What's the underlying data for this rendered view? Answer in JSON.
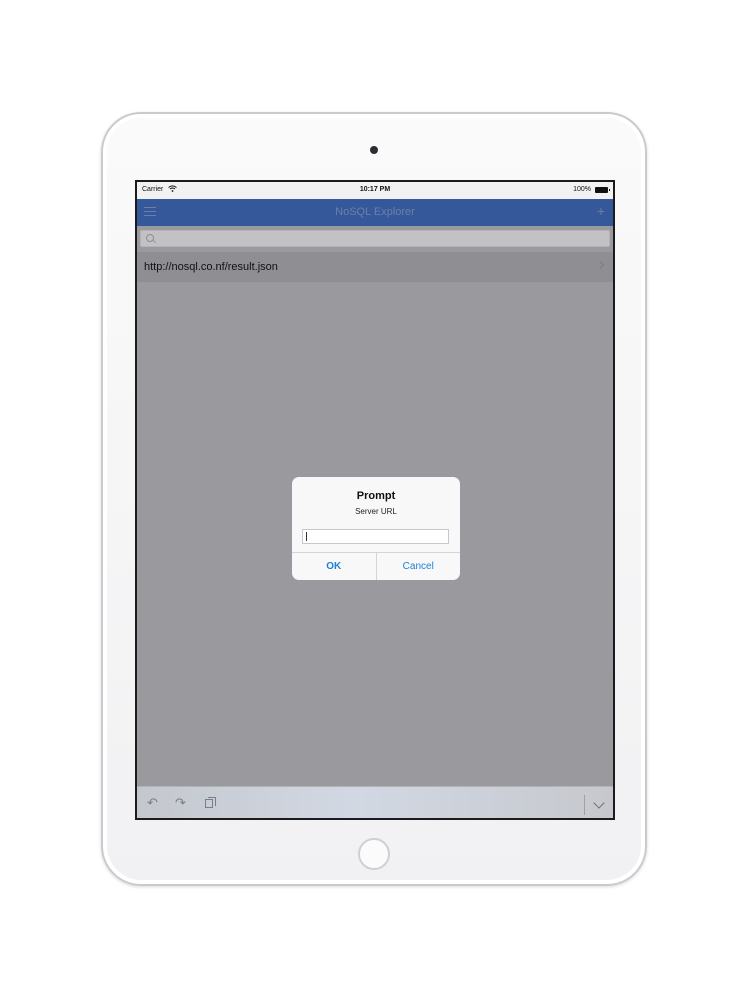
{
  "status_bar": {
    "carrier": "Carrier",
    "time": "10:17 PM",
    "battery": "100%"
  },
  "navbar": {
    "title": "NoSQL Explorer",
    "menu_icon": "hamburger-icon",
    "add_icon": "plus-icon"
  },
  "list": {
    "items": [
      {
        "label": "http://nosql.co.nf/result.json"
      }
    ]
  },
  "alert": {
    "title": "Prompt",
    "message": "Server URL",
    "input_value": "",
    "ok_label": "OK",
    "cancel_label": "Cancel"
  },
  "colors": {
    "navbar": "#34589a",
    "overlay": "#9a999d",
    "alert_button": "#1d7fd8"
  }
}
